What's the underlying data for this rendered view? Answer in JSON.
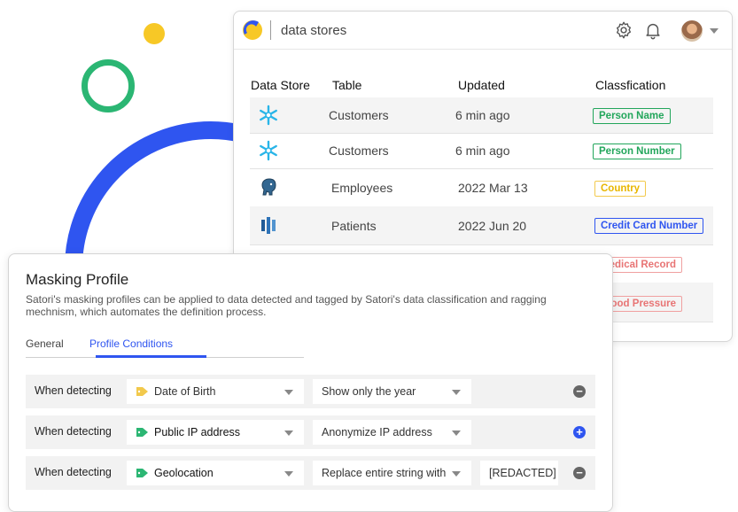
{
  "datastores": {
    "title": "data stores",
    "columns": [
      "Data Store",
      "Table",
      "Updated",
      "Classfication"
    ],
    "rows": [
      {
        "icon": "snowflake-icon",
        "table": "Customers",
        "updated": "6 min ago",
        "classification": "Person Name",
        "badge_color": "#22a65b"
      },
      {
        "icon": "snowflake-icon",
        "table": "Customers",
        "updated": "6 min ago",
        "classification": "Person Number",
        "badge_color": "#22a65b"
      },
      {
        "icon": "postgres-elephant-icon",
        "table": "Employees",
        "updated": "2022 Mar 13",
        "classification": "Country",
        "badge_color": "#e8b600"
      },
      {
        "icon": "redshift-icon",
        "table": "Patients",
        "updated": "2022 Jun 20",
        "classification": "Credit Card Number",
        "badge_color": "#2f55f0"
      },
      {
        "classification": "Medical Record",
        "badge_color": "#e87474"
      },
      {
        "classification": "Blood Pressure",
        "badge_color": "#e87474"
      }
    ]
  },
  "masking": {
    "title": "Masking Profile",
    "description": "Satori's masking profiles can be applied to data detected and tagged by Satori's data classification and ragging mechnism, which automates the definition process.",
    "tabs": [
      "General",
      "Profile Conditions"
    ],
    "active_tab": "Profile Conditions",
    "conditions": [
      {
        "label": "When detecting",
        "field": "Date of Birth",
        "field_bold": false,
        "tag_color": "#f2c94c",
        "action": "Show only the year",
        "value": "",
        "control": "remove"
      },
      {
        "label": "When detecting",
        "field": "Public IP address",
        "field_bold": true,
        "tag_color": "#2bb673",
        "action": "Anonymize IP address",
        "value": "",
        "control": "add"
      },
      {
        "label": "When detecting",
        "field": "Geolocation",
        "field_bold": true,
        "tag_color": "#2bb673",
        "action": "Replace entire string with",
        "value": "[REDACTED]",
        "control": "remove"
      }
    ]
  },
  "colors": {
    "accent": "#2f55f0",
    "green": "#2bb673",
    "yellow": "#f7c826"
  }
}
